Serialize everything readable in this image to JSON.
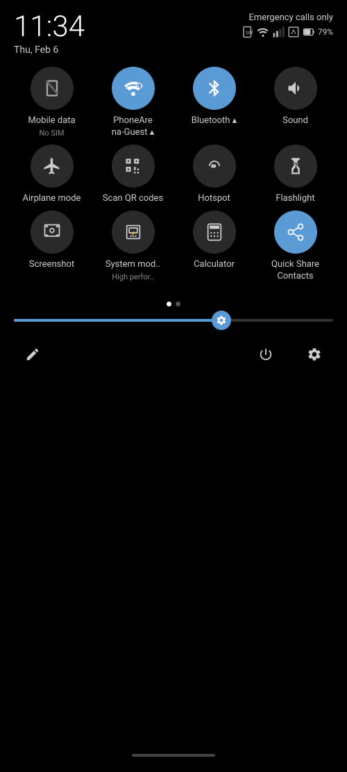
{
  "statusBar": {
    "time": "11:34",
    "date": "Thu, Feb 6",
    "emergency": "Emergency calls only",
    "battery": "79%"
  },
  "quickTiles": [
    [
      {
        "id": "mobile-data",
        "label": "Mobile data",
        "sublabel": "No SIM",
        "active": false,
        "icon": "mobile"
      },
      {
        "id": "phoneareana",
        "label": "PhoneAre na-Guest",
        "sublabel": "",
        "active": true,
        "icon": "wifi"
      },
      {
        "id": "bluetooth",
        "label": "Bluetooth",
        "sublabel": "",
        "active": true,
        "icon": "bluetooth"
      },
      {
        "id": "sound",
        "label": "Sound",
        "sublabel": "",
        "active": false,
        "icon": "sound"
      }
    ],
    [
      {
        "id": "airplane",
        "label": "Airplane mode",
        "sublabel": "",
        "active": false,
        "icon": "airplane"
      },
      {
        "id": "scanqr",
        "label": "Scan QR codes",
        "sublabel": "",
        "active": false,
        "icon": "qr"
      },
      {
        "id": "hotspot",
        "label": "Hotspot",
        "sublabel": "",
        "active": false,
        "icon": "hotspot"
      },
      {
        "id": "flashlight",
        "label": "Flashlight",
        "sublabel": "",
        "active": false,
        "icon": "flashlight"
      }
    ],
    [
      {
        "id": "screenshot",
        "label": "Screenshot",
        "sublabel": "",
        "active": false,
        "icon": "screenshot"
      },
      {
        "id": "systemmod",
        "label": "System mod..",
        "sublabel": "High perfor..",
        "active": false,
        "icon": "sysmod"
      },
      {
        "id": "calculator",
        "label": "Calculator",
        "sublabel": "",
        "active": false,
        "icon": "calculator"
      },
      {
        "id": "quickshare",
        "label": "Quick Share Contacts",
        "sublabel": "",
        "active": true,
        "icon": "quickshare"
      }
    ]
  ],
  "brightness": {
    "fillPercent": 65
  },
  "dots": [
    {
      "active": true
    },
    {
      "active": false
    }
  ],
  "toolbar": {
    "edit": "✏",
    "power": "⏻",
    "settings": "⚙"
  }
}
